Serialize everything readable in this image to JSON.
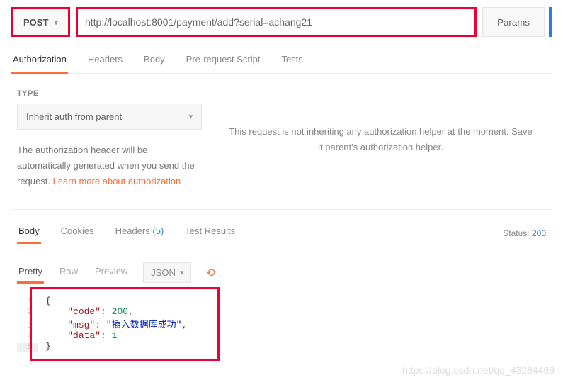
{
  "request": {
    "method": "POST",
    "url": "http://localhost:8001/payment/add?serial=achang21",
    "params_label": "Params"
  },
  "tabs": {
    "authorization": "Authorization",
    "headers": "Headers",
    "body": "Body",
    "prerequest": "Pre-request Script",
    "tests": "Tests"
  },
  "auth": {
    "type_label": "TYPE",
    "type_value": "Inherit auth from parent",
    "desc_pre": "The authorization header will be automatically generated when you send the request. ",
    "desc_link": "Learn more about authorization",
    "right_msg": "This request is not inheriting any authorization helper at the moment. Save it parent's authorization helper."
  },
  "response": {
    "tabs": {
      "body": "Body",
      "cookies": "Cookies",
      "headers": "Headers",
      "headers_count": "(5)",
      "test_results": "Test Results"
    },
    "status_label": "Status:",
    "status_code": "200",
    "view": {
      "pretty": "Pretty",
      "raw": "Raw",
      "preview": "Preview",
      "format": "JSON"
    },
    "lines": [
      "1",
      "2",
      "3",
      "4",
      "5"
    ],
    "json": {
      "code_key": "\"code\"",
      "code_val": "200",
      "msg_key": "\"msg\"",
      "msg_val": "\"插入数据库成功\"",
      "data_key": "\"data\"",
      "data_val": "1"
    }
  },
  "watermark": "https://blog.csdn.net/qq_43284469"
}
